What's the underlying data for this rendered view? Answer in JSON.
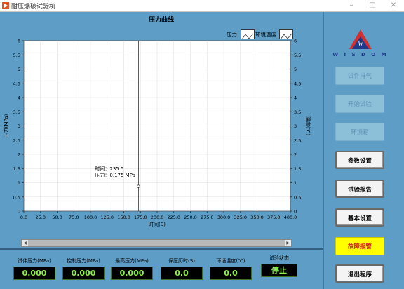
{
  "window": {
    "title": "耐压爆破试验机",
    "minimize": "–",
    "maximize": "□",
    "close": "✕"
  },
  "chart_title": "压力曲线",
  "legend": [
    {
      "name": "压力"
    },
    {
      "name": "环境温度"
    }
  ],
  "chart_data": {
    "type": "line",
    "title": "压力曲线",
    "xlabel": "时间(S)",
    "ylabel": "压力(MPa)",
    "y2label": "温度(℃)",
    "xlim": [
      0,
      400
    ],
    "ylim": [
      0,
      6
    ],
    "y2lim": [
      0,
      6
    ],
    "x_ticks": [
      "0.0",
      "25.0",
      "50.0",
      "75.0",
      "100.0",
      "125.0",
      "150.0",
      "175.0",
      "200.0",
      "225.0",
      "250.0",
      "275.0",
      "300.0",
      "325.0",
      "350.0",
      "375.0",
      "400.0"
    ],
    "y_ticks": [
      "0",
      "0.5",
      "1",
      "1.5",
      "2",
      "2.5",
      "3",
      "3.5",
      "4",
      "4.5",
      "5",
      "5.5",
      "6"
    ],
    "y2_ticks": [
      "0",
      "0.5",
      "1",
      "1.5",
      "2",
      "2.5",
      "3",
      "3.5",
      "4",
      "4.5",
      "5",
      "5.5",
      "6"
    ],
    "grid": true,
    "series": [
      {
        "name": "压力",
        "values": []
      },
      {
        "name": "环境温度",
        "values": []
      }
    ],
    "cursor": {
      "x": 172,
      "y": 0.875,
      "label_time": "时间：235.5",
      "label_pressure": "压力：0.175 MPa"
    }
  },
  "indicators": [
    {
      "label": "试件压力(MPa)",
      "value": "0.000"
    },
    {
      "label": "控制压力(MPa)",
      "value": "0.000"
    },
    {
      "label": "最高压力(MPa)",
      "value": "0.000"
    },
    {
      "label": "保压历时(S)",
      "value": "0.0"
    },
    {
      "label": "环境温度(℃)",
      "value": "0.0"
    },
    {
      "label": "试验状态",
      "value": "停止"
    }
  ],
  "logo": {
    "text": "W I S D O M",
    "letter": "W",
    "colors": {
      "top": "#d32f2f",
      "bottom": "#1e3a8a"
    }
  },
  "buttons": [
    {
      "label": "试件排气",
      "state": "disabled"
    },
    {
      "label": "开始试验",
      "state": "disabled"
    },
    {
      "label": "环境箱",
      "state": "disabled"
    },
    {
      "label": "参数设置",
      "state": "active"
    },
    {
      "label": "试验报告",
      "state": "active"
    },
    {
      "label": "基本设置",
      "state": "active"
    },
    {
      "label": "故障报警",
      "state": "alarm"
    },
    {
      "label": "退出程序",
      "state": "active"
    }
  ],
  "colors": {
    "background": "#5d9dc6",
    "plot": "#ffffff",
    "grid": "#e0e0e0",
    "indicator_text": "#8cf04a"
  }
}
